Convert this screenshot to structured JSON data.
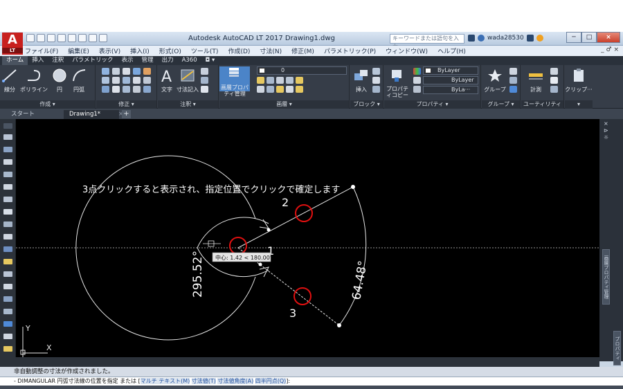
{
  "titlebar": {
    "logo": "A",
    "logo_sub": "LT",
    "title": "Autodesk AutoCAD LT 2017    Drawing1.dwg",
    "search_placeholder": "キーワードまたは語句を入力",
    "user": "wada28530",
    "win_minimize": "─",
    "win_maximize": "□",
    "win_close": "×"
  },
  "menu": {
    "items": [
      "ファイル(F)",
      "編集(E)",
      "表示(V)",
      "挿入(I)",
      "形式(O)",
      "ツール(T)",
      "作成(D)",
      "寸法(N)",
      "修正(M)",
      "パラメトリック(P)",
      "ウィンドウ(W)",
      "ヘルプ(H)"
    ],
    "mdi_controls": "_ ♂ ×"
  },
  "ribbon": {
    "tabs": [
      "ホーム",
      "挿入",
      "注釈",
      "パラメトリック",
      "表示",
      "管理",
      "出力",
      "A360",
      "◘ ▾"
    ],
    "active_tab": 0,
    "groups": {
      "draw": {
        "title": "作成 ▾",
        "tools": [
          "線分",
          "ポリライン",
          "円",
          "円弧"
        ]
      },
      "modify": {
        "title": "修正 ▾"
      },
      "annotation": {
        "title": "注釈 ▾",
        "tools": [
          "文字",
          "寸法記入"
        ]
      },
      "layers": {
        "title": "画層 ▾",
        "tool": "画層プロパティ管理",
        "current_layer": "0"
      },
      "block": {
        "title": "ブロック ▾",
        "tool": "挿入"
      },
      "properties": {
        "title": "プロパティ ▾",
        "tool": "プロパティコピー",
        "color": "ByLayer",
        "linetype": "ByLayer",
        "lineweight": "ByLa···"
      },
      "groups": {
        "title": "グループ ▾",
        "tool": "グループ"
      },
      "utilities": {
        "title": "ユーティリティ ▾",
        "tool": "計測"
      },
      "clipboard": {
        "title": "▾",
        "tool": "クリップ···"
      }
    }
  },
  "filetabs": {
    "start": "スタート",
    "drawing": "Drawing1*",
    "close": "×",
    "new": "+"
  },
  "canvas": {
    "annotation_text": "3点クリックすると表示され、指定位置でクリックで確定します",
    "labels": {
      "p1": "1",
      "p2": "2",
      "p3": "3"
    },
    "dim_major": "295.52°",
    "dim_minor": "64.48°",
    "tooltip": "中心: 1.42 < 180.00°",
    "ucs_y": "Y",
    "ucs_x": "X"
  },
  "right_strip": {
    "layer_palette": "画層プロパティ管理",
    "properties_palette": "プロパティ"
  },
  "command": {
    "history": "非自動調整の寸法が作成されました。",
    "prompt": "- DIMANGULAR 円弧寸法線の位置を指定 または [",
    "options": [
      "マルチ テキスト(M)",
      "寸法値(T)",
      "寸法値角度(A)",
      "四半円点(Q)"
    ],
    "prompt_end": "]:"
  },
  "colors": {
    "canvas_bg": "#000000",
    "geometry": "#ffffff",
    "marker": "#e01010",
    "ribbon_bg": "#363d48"
  }
}
